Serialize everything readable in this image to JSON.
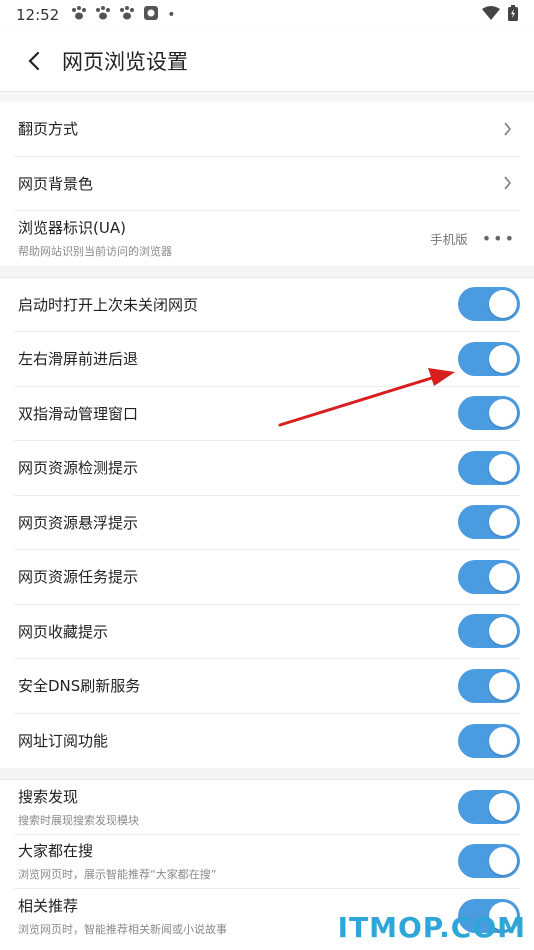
{
  "status_bar": {
    "time": "12:52",
    "dot": "•"
  },
  "header": {
    "title": "网页浏览设置"
  },
  "group1": [
    {
      "label": "翻页方式"
    },
    {
      "label": "网页背景色"
    },
    {
      "label": "浏览器标识(UA)",
      "sub": "帮助网站识别当前访问的浏览器",
      "value": "手机版",
      "more": "•••"
    }
  ],
  "group2": [
    {
      "label": "启动时打开上次未关闭网页",
      "on": true
    },
    {
      "label": "左右滑屏前进后退",
      "on": true
    },
    {
      "label": "双指滑动管理窗口",
      "on": true
    },
    {
      "label": "网页资源检测提示",
      "on": true
    },
    {
      "label": "网页资源悬浮提示",
      "on": true
    },
    {
      "label": "网页资源任务提示",
      "on": true
    },
    {
      "label": "网页收藏提示",
      "on": true
    },
    {
      "label": "安全DNS刷新服务",
      "on": true
    },
    {
      "label": "网址订阅功能",
      "on": true
    }
  ],
  "group3": [
    {
      "label": "搜索发现",
      "sub": "搜索时展现搜索发现模块",
      "on": true
    },
    {
      "label": "大家都在搜",
      "sub": "浏览网页时，展示智能推荐“大家都在搜”",
      "on": true
    },
    {
      "label": "相关推荐",
      "sub": "浏览网页时，智能推荐相关新闻或小说故事",
      "on": true
    }
  ],
  "watermark": "ITMOP.COM",
  "colors": {
    "toggle_on": "#4a9be0",
    "arrow": "#d81e1e",
    "watermark": "#2ea6d8"
  }
}
